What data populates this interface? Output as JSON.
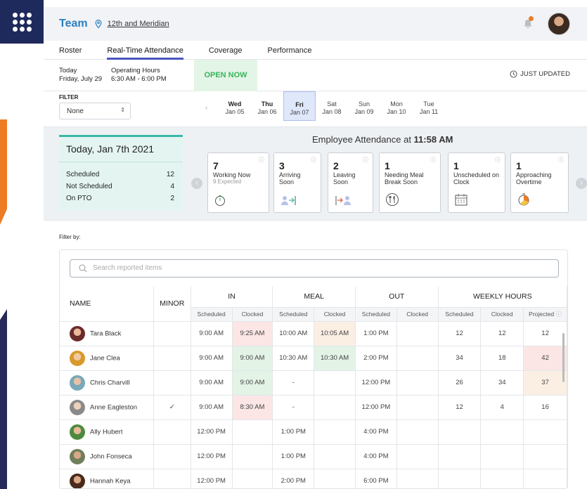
{
  "header": {
    "team": "Team",
    "location": "12th and Meridian"
  },
  "tabs": [
    "Roster",
    "Real-Time Attendance",
    "Coverage",
    "Performance"
  ],
  "status": {
    "today_label": "Today",
    "today_date": "Friday, July 29",
    "hours_label": "Operating Hours",
    "hours_value": "6:30 AM - 6:00 PM",
    "open_label": "OPEN NOW",
    "updated": "JUST UPDATED"
  },
  "filter": {
    "label": "FILTER",
    "value": "None"
  },
  "days": [
    {
      "name": "Wed",
      "date": "Jan 05"
    },
    {
      "name": "Thu",
      "date": "Jan 06"
    },
    {
      "name": "Fri",
      "date": "Jan 07"
    },
    {
      "name": "Sat",
      "date": "Jan 08"
    },
    {
      "name": "Sun",
      "date": "Jan 09"
    },
    {
      "name": "Mon",
      "date": "Jan 10"
    },
    {
      "name": "Tue",
      "date": "Jan 11"
    }
  ],
  "summary": {
    "title": "Today, Jan 7th 2021",
    "rows": [
      {
        "label": "Scheduled",
        "value": "12"
      },
      {
        "label": "Not Scheduled",
        "value": "4"
      },
      {
        "label": "On PTO",
        "value": "2"
      }
    ]
  },
  "attendance": {
    "title_prefix": "Employee Attendance at ",
    "time": "11:58 AM",
    "cards": [
      {
        "num": "7",
        "label": "Working Now",
        "sub": "9 Expected",
        "icon": "stopwatch-icon"
      },
      {
        "num": "3",
        "label": "Arriving Soon",
        "sub": "",
        "icon": "arriving-person-icon"
      },
      {
        "num": "2",
        "label": "Leaving Soon",
        "sub": "",
        "icon": "leaving-person-icon"
      },
      {
        "num": "1",
        "label": "Needing Meal Break Soon",
        "sub": "",
        "icon": "meal-icon"
      },
      {
        "num": "1",
        "label": "Unscheduled on Clock",
        "sub": "",
        "icon": "calendar-icon"
      },
      {
        "num": "1",
        "label": "Approaching Overtime",
        "sub": "",
        "icon": "overtime-timer-icon"
      }
    ]
  },
  "table": {
    "filter_by": "Filter by:",
    "search_placeholder": "Search reported items",
    "groups": [
      "NAME",
      "MINOR",
      "IN",
      "MEAL",
      "OUT",
      "WEEKLY HOURS"
    ],
    "subheaders": [
      "Scheduled",
      "Clocked",
      "Scheduled",
      "Clocked",
      "Scheduled",
      "Clocked",
      "Scheduled",
      "Clocked",
      "Projected"
    ],
    "rows": [
      {
        "name": "Tara Black",
        "minor": "",
        "in_s": "9:00 AM",
        "in_c": "9:25 AM",
        "meal_s": "10:00 AM",
        "meal_c": "10:05 AM",
        "out_s": "1:00 PM",
        "out_c": "",
        "wk_s": "12",
        "wk_c": "12",
        "wk_p": "12"
      },
      {
        "name": "Jane Clea",
        "minor": "",
        "in_s": "9:00 AM",
        "in_c": "9:00 AM",
        "meal_s": "10:30 AM",
        "meal_c": "10:30 AM",
        "out_s": "2:00 PM",
        "out_c": "",
        "wk_s": "34",
        "wk_c": "18",
        "wk_p": "42"
      },
      {
        "name": "Chris Charvill",
        "minor": "",
        "in_s": "9:00 AM",
        "in_c": "9:00 AM",
        "meal_s": "-",
        "meal_c": "",
        "out_s": "12:00 PM",
        "out_c": "",
        "wk_s": "26",
        "wk_c": "34",
        "wk_p": "37"
      },
      {
        "name": "Anne Eagleston",
        "minor": "✓",
        "in_s": "9:00 AM",
        "in_c": "8:30 AM",
        "meal_s": "-",
        "meal_c": "",
        "out_s": "12:00 PM",
        "out_c": "",
        "wk_s": "12",
        "wk_c": "4",
        "wk_p": "16"
      },
      {
        "name": "Ally Hubert",
        "minor": "",
        "in_s": "12:00 PM",
        "in_c": "",
        "meal_s": "1:00 PM",
        "meal_c": "",
        "out_s": "4:00 PM",
        "out_c": "",
        "wk_s": "",
        "wk_c": "",
        "wk_p": ""
      },
      {
        "name": "John Fonseca",
        "minor": "",
        "in_s": "12:00 PM",
        "in_c": "",
        "meal_s": "1:00 PM",
        "meal_c": "",
        "out_s": "4:00 PM",
        "out_c": "",
        "wk_s": "",
        "wk_c": "",
        "wk_p": ""
      },
      {
        "name": "Hannah Keya",
        "minor": "",
        "in_s": "12:00 PM",
        "in_c": "",
        "meal_s": "2:00 PM",
        "meal_c": "",
        "out_s": "6:00 PM",
        "out_c": "",
        "wk_s": "",
        "wk_c": "",
        "wk_p": ""
      }
    ]
  },
  "colors": {
    "brand_navy": "#1f2a5c",
    "accent_blue": "#2c7fbf",
    "tab_underline": "#4a56c0",
    "open_green": "#38b55a",
    "summary_teal": "#3bb8a6",
    "late_red": "#fbe5e5",
    "ok_green": "#e3f3e6",
    "warn_peach": "#fbefe4"
  }
}
